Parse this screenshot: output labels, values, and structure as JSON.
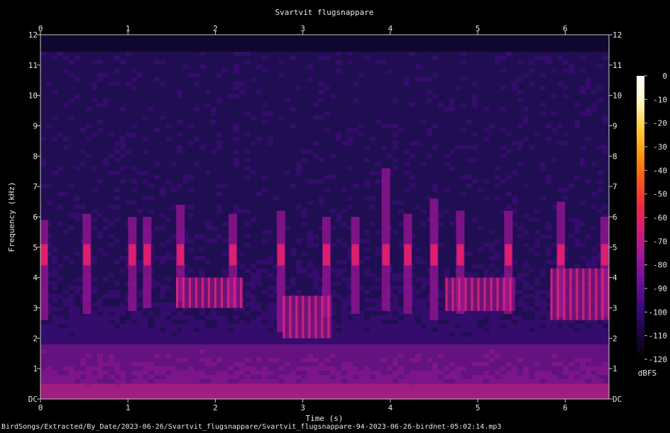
{
  "chart_data": {
    "type": "heatmap",
    "title": "Svartvit flugsnappare",
    "xlabel": "Time (s)",
    "ylabel": "Frequency (kHz)",
    "xlim": [
      0,
      6.5
    ],
    "ylim": [
      0,
      12
    ],
    "x_ticks": [
      "0",
      "1",
      "2",
      "3",
      "4",
      "5",
      "6"
    ],
    "x_tick_values": [
      0,
      1,
      2,
      3,
      4,
      5,
      6
    ],
    "y_ticks": [
      "DC",
      "1",
      "2",
      "3",
      "4",
      "5",
      "6",
      "7",
      "8",
      "9",
      "10",
      "11",
      "12"
    ],
    "y_tick_values": [
      0,
      1,
      2,
      3,
      4,
      5,
      6,
      7,
      8,
      9,
      10,
      11,
      12
    ],
    "colorbar": {
      "label": "dBFS",
      "ticks": [
        "0",
        "-10",
        "-20",
        "-30",
        "-40",
        "-50",
        "-60",
        "-70",
        "-80",
        "-90",
        "-100",
        "-110",
        "-120"
      ],
      "tick_values": [
        0,
        -10,
        -20,
        -30,
        -40,
        -50,
        -60,
        -70,
        -80,
        -90,
        -100,
        -110,
        -120
      ],
      "colors": [
        "#000000",
        "#1a0640",
        "#3a0a7a",
        "#6a0f9a",
        "#a0169a",
        "#d01c78",
        "#f02a40",
        "#ff5a1a",
        "#ff9a10",
        "#ffd040",
        "#fff8c0",
        "#ffffff"
      ]
    },
    "grid": false,
    "calls": [
      {
        "t": 0.04,
        "f_low": 2.6,
        "f_high": 5.9
      },
      {
        "t": 0.53,
        "f_low": 2.8,
        "f_high": 6.1
      },
      {
        "t": 1.05,
        "f_low": 2.9,
        "f_high": 6.0
      },
      {
        "t": 1.22,
        "f_low": 3.0,
        "f_high": 6.0
      },
      {
        "t": 1.6,
        "f_low": 3.2,
        "f_high": 6.4
      },
      {
        "t": 2.2,
        "f_low": 3.0,
        "f_high": 6.1
      },
      {
        "t": 2.75,
        "f_low": 2.2,
        "f_high": 6.2
      },
      {
        "t": 3.27,
        "f_low": 2.7,
        "f_high": 6.0
      },
      {
        "t": 3.6,
        "f_low": 2.8,
        "f_high": 6.0
      },
      {
        "t": 3.95,
        "f_low": 2.9,
        "f_high": 7.6
      },
      {
        "t": 4.2,
        "f_low": 2.8,
        "f_high": 6.1
      },
      {
        "t": 4.5,
        "f_low": 2.6,
        "f_high": 6.6
      },
      {
        "t": 4.8,
        "f_low": 2.8,
        "f_high": 6.2
      },
      {
        "t": 5.35,
        "f_low": 2.8,
        "f_high": 6.2
      },
      {
        "t": 5.95,
        "f_low": 2.7,
        "f_high": 6.5
      },
      {
        "t": 6.45,
        "f_low": 2.7,
        "f_high": 6.0
      }
    ],
    "trills": [
      {
        "t0": 1.55,
        "t1": 2.32,
        "f_low": 3.0,
        "f_high": 4.0
      },
      {
        "t0": 2.77,
        "t1": 3.33,
        "f_low": 2.0,
        "f_high": 3.4
      },
      {
        "t0": 4.63,
        "t1": 5.43,
        "f_low": 2.9,
        "f_high": 4.0
      },
      {
        "t0": 5.83,
        "t1": 6.5,
        "f_low": 2.6,
        "f_high": 4.3
      }
    ]
  },
  "footer_path": "BirdSongs/Extracted/By_Date/2023-06-26/Svartvit_flugsnappare/Svartvit_flugsnappare-94-2023-06-26-birdnet-05:02:14.mp3"
}
